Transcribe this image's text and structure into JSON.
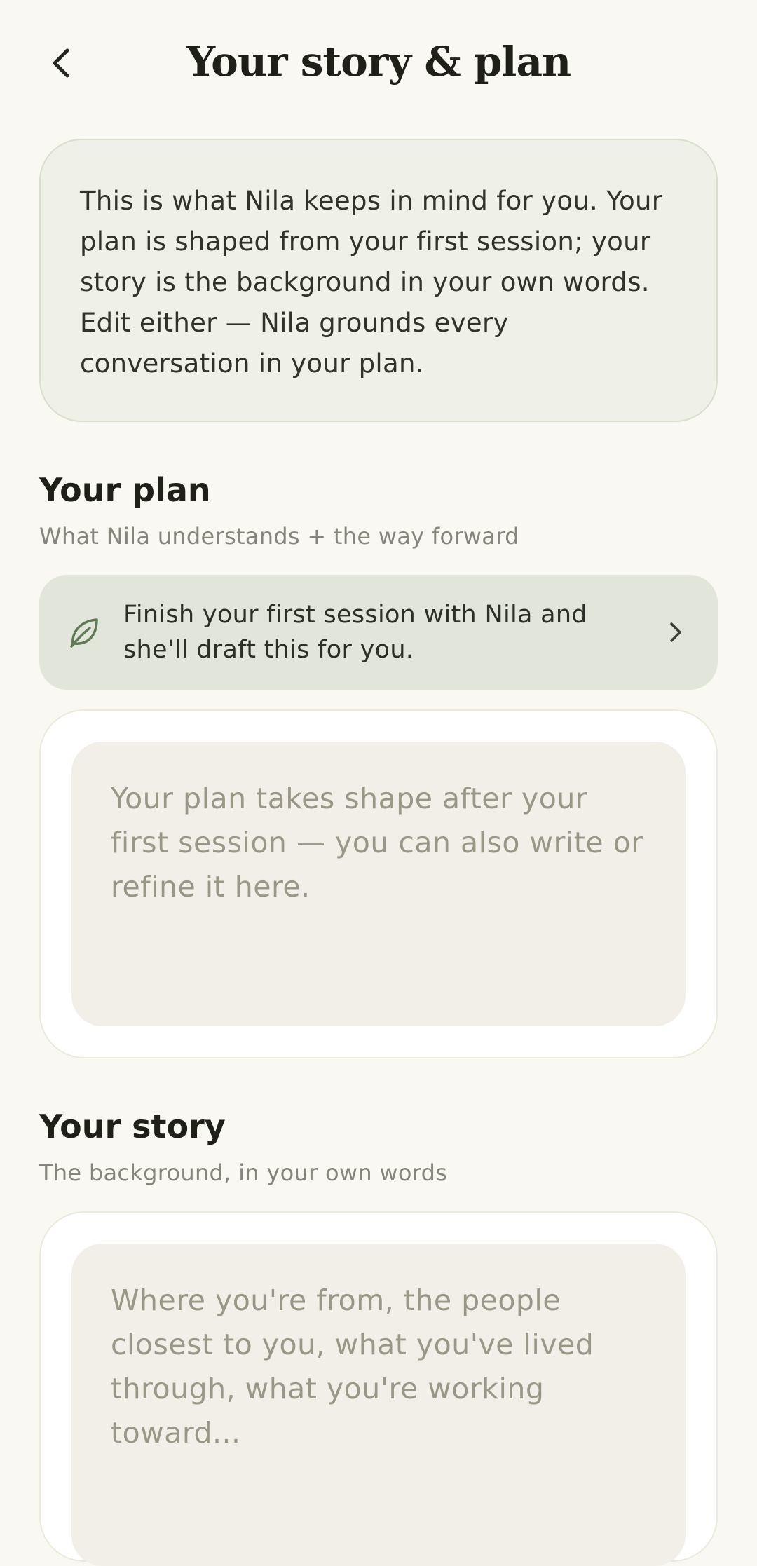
{
  "header": {
    "title": "Your story & plan"
  },
  "intro": {
    "text": "This is what Nila keeps in mind for you. Your plan is shaped from your first session; your story is the background in your own words. Edit either — Nila grounds every conversation in your plan."
  },
  "plan": {
    "title": "Your plan",
    "subtitle": "What Nila understands + the way forward",
    "hint": "Finish your first session with Nila and she'll draft this for you.",
    "placeholder": "Your plan takes shape after your first session — you can also write or refine it here."
  },
  "story": {
    "title": "Your story",
    "subtitle": "The background, in your own words",
    "placeholder": "Where you're from, the people closest to you, what you've lived through, what you're working toward..."
  },
  "icons": {
    "back": "chevron-left-icon",
    "leaf": "leaf-icon",
    "forward": "chevron-right-icon"
  },
  "colors": {
    "background": "#f9f8f3",
    "accent_green": "#5d7a55",
    "intro_card": "#eff0e8",
    "hint_banner": "#e2e6da",
    "field_fill": "#f1efe7"
  }
}
